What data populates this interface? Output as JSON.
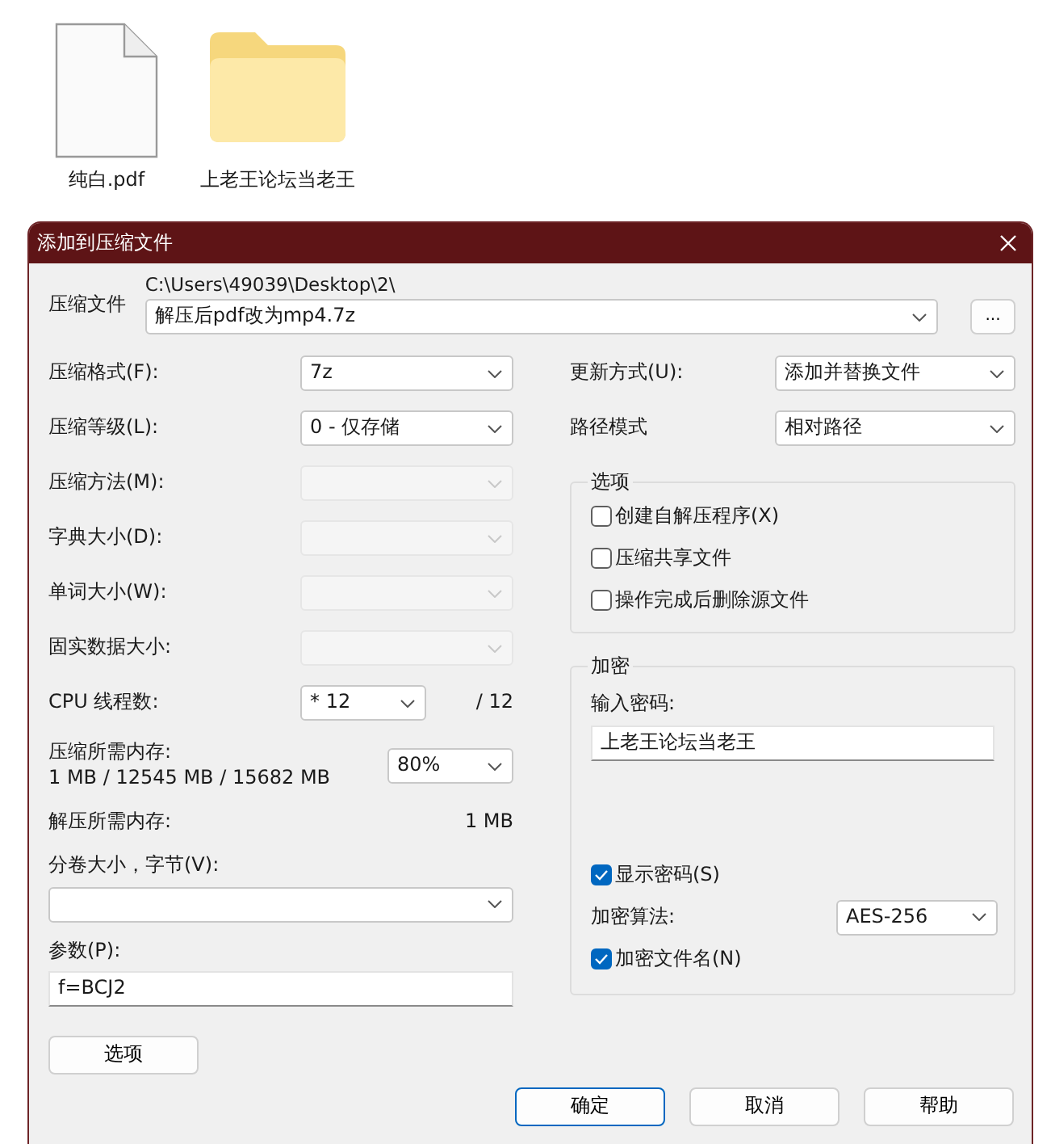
{
  "desktop": {
    "icons": [
      {
        "kind": "file",
        "label": "纯白.pdf"
      },
      {
        "kind": "folder",
        "label": "上老王论坛当老王"
      }
    ]
  },
  "dialog": {
    "title": "添加到压缩文件",
    "archive": {
      "label": "压缩文件",
      "path": "C:\\Users\\49039\\Desktop\\2\\",
      "value": "解压后pdf改为mp4.7z",
      "browse": "..."
    },
    "left_rows": [
      {
        "kind": "select",
        "label": "压缩格式(F):",
        "value": "7z",
        "disabled": false
      },
      {
        "kind": "select",
        "label": "压缩等级(L):",
        "value": "0 - 仅存储",
        "disabled": false
      },
      {
        "kind": "select",
        "label": "压缩方法(M):",
        "disabled": true
      },
      {
        "kind": "select",
        "label": "字典大小(D):",
        "disabled": true
      },
      {
        "kind": "select",
        "label": "单词大小(W):",
        "disabled": true
      },
      {
        "kind": "select",
        "label": "固实数据大小:",
        "disabled": true
      },
      {
        "kind": "cpu",
        "label": "CPU 线程数:",
        "value": "* 12",
        "suffix": "/ 12"
      },
      {
        "kind": "memory",
        "label": "压缩所需内存:",
        "detail": "1 MB / 12545 MB / 15682 MB",
        "value": "80%"
      },
      {
        "kind": "info",
        "label": "解压所需内存:",
        "value": "1 MB"
      },
      {
        "kind": "combo",
        "label": "分卷大小，字节(V):"
      },
      {
        "kind": "text",
        "label": "参数(P):",
        "value": "f=BCJ2"
      }
    ],
    "options_button": "选项",
    "right_rows": [
      {
        "label": "更新方式(U):",
        "value": "添加并替换文件"
      },
      {
        "label": "路径模式",
        "value": "相对路径"
      }
    ],
    "options_group": {
      "title": "选项",
      "items": [
        {
          "label": "创建自解压程序(X)",
          "checked": false
        },
        {
          "label": "压缩共享文件",
          "checked": false
        },
        {
          "label": "操作完成后删除源文件",
          "checked": false
        }
      ]
    },
    "encryption": {
      "title": "加密",
      "password_label": "输入密码:",
      "password": "上老王论坛当老王",
      "show_password": {
        "label": "显示密码(S)",
        "checked": true
      },
      "method_label": "加密算法:",
      "method": "AES-256",
      "encrypt_names": {
        "label": "加密文件名(N)",
        "checked": true
      }
    },
    "buttons": [
      {
        "label": "确定",
        "default": true
      },
      {
        "label": "取消",
        "default": false
      },
      {
        "label": "帮助",
        "default": false
      }
    ]
  }
}
